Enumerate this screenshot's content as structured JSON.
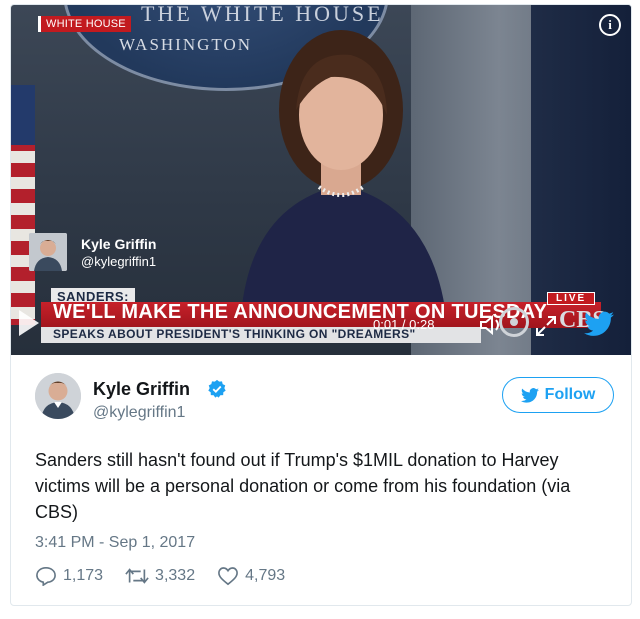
{
  "video": {
    "tag": "WHITE HOUSE",
    "seal_top": "THE WHITE HOUSE",
    "seal_sub": "WASHINGTON",
    "info_icon": "info-icon",
    "inner_author": {
      "name": "Kyle Griffin",
      "handle": "@kylegriffin1"
    },
    "lower_third": {
      "label": "SANDERS:",
      "headline": "WE'LL MAKE THE ANNOUNCEMENT ON TUESDAY",
      "sub": "SPEAKS ABOUT PRESIDENT'S THINKING ON \"DREAMERS\"",
      "live": "LIVE",
      "network": "CBS"
    },
    "controls": {
      "time": "0:01 / 0:28",
      "play_icon": "play-icon",
      "volume_icon": "volume-icon",
      "expand_icon": "expand-icon",
      "brand_icon": "twitter-bird-icon"
    }
  },
  "tweet": {
    "author": {
      "name": "Kyle Griffin",
      "handle": "@kylegriffin1",
      "verified": true
    },
    "follow_label": "Follow",
    "text": "Sanders still hasn't found out if Trump's $1MIL donation to Harvey victims will be a personal donation or come from his foundation (via CBS)",
    "timestamp": "3:41 PM - Sep 1, 2017",
    "actions": {
      "replies": "1,173",
      "retweets": "3,332",
      "likes": "4,793"
    }
  },
  "colors": {
    "twitter_blue": "#1da1f2",
    "text": "#14171a",
    "secondary": "#657786",
    "news_red": "#c21a1f"
  }
}
